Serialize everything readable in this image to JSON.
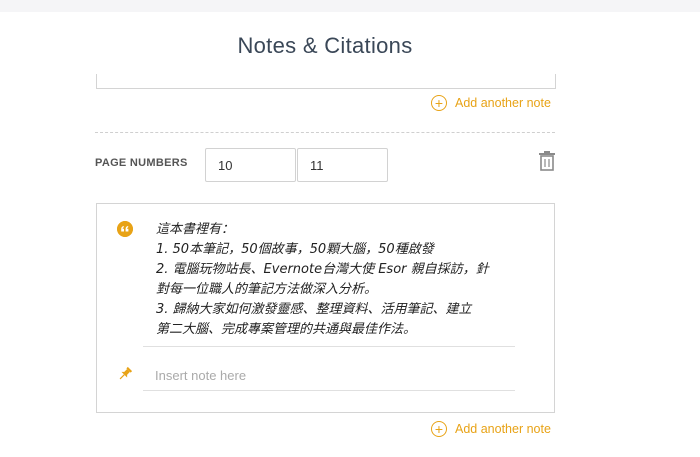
{
  "header": {
    "title": "Notes & Citations"
  },
  "actions": {
    "add_note_label_top": "Add another note",
    "add_note_label_bottom": "Add another note"
  },
  "page_numbers": {
    "label": "PAGE NUMBERS",
    "start": "10",
    "end": "11"
  },
  "note": {
    "quote_lines": [
      "這本書裡有：",
      "1. 50本筆記，50個故事，50顆大腦，50種啟發",
      "2. 電腦玩物站長、Evernote台灣大使 Esor 親自採訪，針",
      "對每一位職人的筆記方法做深入分析。",
      "3. 歸納大家如何激發靈感、整理資料、活用筆記、建立",
      "第二大腦、完成專案管理的共通與最佳作法。"
    ],
    "insert_placeholder": "Insert note here"
  },
  "icons": {
    "quote": "quote-icon",
    "pin": "pin-icon",
    "trash": "trash-icon",
    "plus": "plus-circle-icon"
  },
  "colors": {
    "accent": "#e8a317",
    "title": "#3a4757",
    "border": "#d4d4d4"
  }
}
